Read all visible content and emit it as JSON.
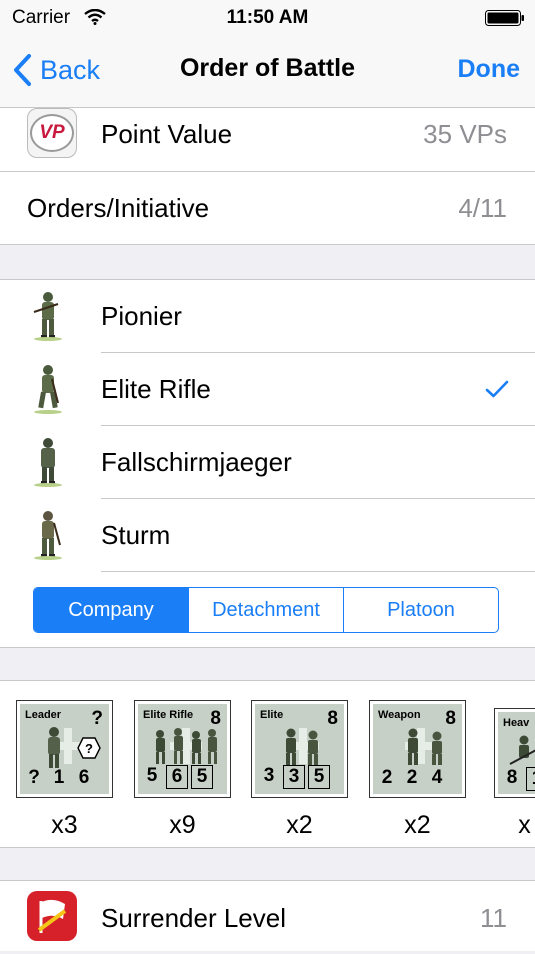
{
  "status_bar": {
    "carrier": "Carrier",
    "time": "11:50 AM"
  },
  "nav": {
    "back_label": "Back",
    "title": "Order of Battle",
    "done_label": "Done"
  },
  "summary": [
    {
      "icon": "vp-icon",
      "label": "Point Value",
      "value": "35 VPs"
    },
    {
      "label": "Orders/Initiative",
      "value": "4/11"
    }
  ],
  "unit_types": [
    {
      "label": "Pionier",
      "selected": false
    },
    {
      "label": "Elite Rifle",
      "selected": true
    },
    {
      "label": "Fallschirmjaeger",
      "selected": false
    },
    {
      "label": "Sturm",
      "selected": false
    }
  ],
  "formation": {
    "segments": [
      "Company",
      "Detachment",
      "Platoon"
    ],
    "selected": "Company"
  },
  "counters": [
    {
      "title": "Leader",
      "top_value": "?",
      "stats": [
        "?",
        "1",
        "6"
      ],
      "boxed": [],
      "multiplier": "x3"
    },
    {
      "title": "Elite Rifle",
      "top_value": "8",
      "stats": [
        "5",
        "6",
        "5"
      ],
      "boxed": [
        1,
        2
      ],
      "multiplier": "x9"
    },
    {
      "title": "Elite",
      "top_value": "8",
      "stats": [
        "3",
        "3",
        "5"
      ],
      "boxed": [
        1,
        2
      ],
      "multiplier": "x2"
    },
    {
      "title": "Weapon",
      "top_value": "8",
      "stats": [
        "2",
        "2",
        "4"
      ],
      "boxed": [],
      "multiplier": "x2"
    },
    {
      "title": "Heav",
      "top_value": "",
      "stats": [
        "8",
        "1"
      ],
      "boxed": [
        1
      ],
      "multiplier": "x"
    }
  ],
  "surrender": {
    "icon": "surrender-flag-icon",
    "label": "Surrender Level",
    "value": "11"
  },
  "colors": {
    "accent": "#1a7ef6",
    "secondary_text": "#8e8e93",
    "background": "#efeff4",
    "vp_red": "#c8193d",
    "surrender_red": "#d6202a"
  }
}
